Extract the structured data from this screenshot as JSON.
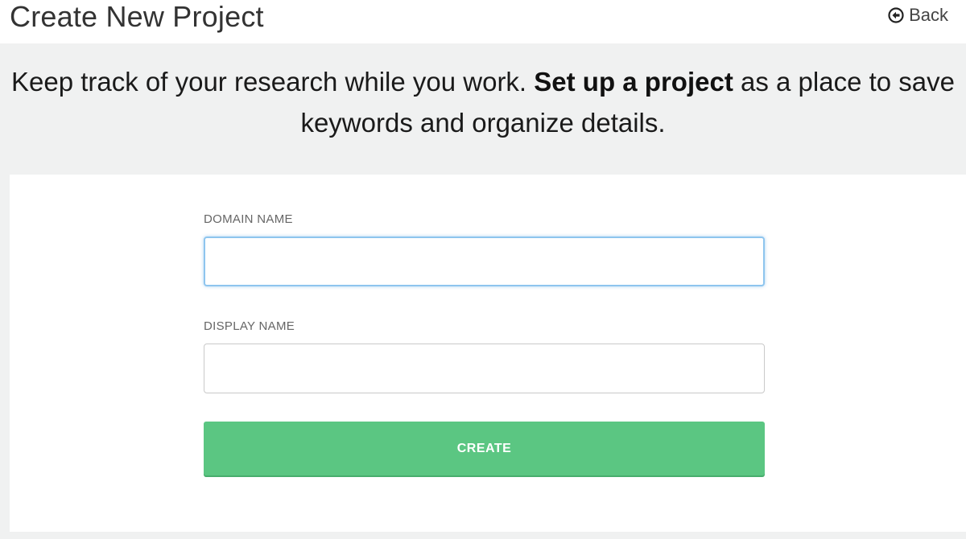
{
  "header": {
    "title": "Create New Project",
    "back_label": "Back"
  },
  "intro": {
    "text_before": "Keep track of your research while you work.",
    "bold": "Set up a project",
    "text_after": "as a place to save keywords and organize details."
  },
  "form": {
    "domain_label": "DOMAIN NAME",
    "domain_value": "",
    "display_label": "DISPLAY NAME",
    "display_value": "",
    "create_label": "CREATE"
  },
  "colors": {
    "accent_green": "#5bc682",
    "focus_blue": "#8ec5ee",
    "background": "#f0f1f1"
  },
  "icons": {
    "back": "circle-arrow-left-icon"
  }
}
